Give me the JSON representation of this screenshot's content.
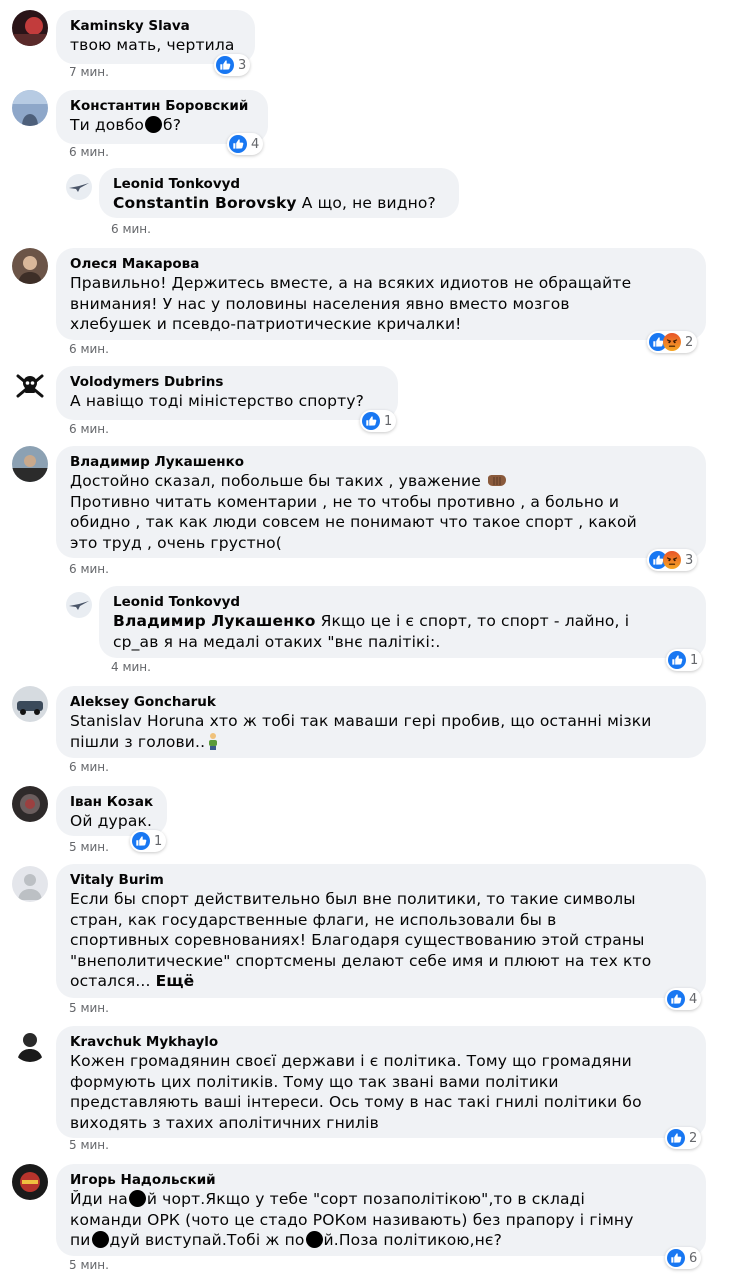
{
  "comments": [
    {
      "author": "Kaminsky Slava",
      "text": "твою мать, чертила",
      "time": "7 мин.",
      "reactions": "3",
      "avatar": "avatar-image"
    },
    {
      "author": "Константин Боровский",
      "text_a": "Ти довбо",
      "text_b": "б?",
      "time": "6 мин.",
      "reactions": "4",
      "avatar": "avatar-image"
    },
    {
      "author": "Leonid Tonkovyd",
      "mention": "Constantin Borovsky",
      "text": " А що, не видно?",
      "time": "6 мин.",
      "avatar": "airplane-avatar"
    },
    {
      "author": "Олеся Макарова",
      "lines": [
        "Правильно! Держитесь вместе, а на всяких идиотов не обращайте",
        "внимания! У нас у половины населения явно вместо мозгов",
        "хлебушек и псевдо-патриотические кричалки!"
      ],
      "time": "6 мин.",
      "reactions": "2"
    },
    {
      "author": "Volodymers Dubrins",
      "text": "А навіщо тоді міністерство спорту?",
      "time": "6 мин.",
      "reactions": "1",
      "avatar": "skull-avatar"
    },
    {
      "author": "Владимир Лукашенко",
      "lines": [
        "Достойно сказал, побольше бы таких , уважение",
        "Противно читать коментарии , не то чтобы противно , а больно и",
        "обидно , так как люди совсем не понимают что такое спорт , какой",
        "это труд , очень грустно("
      ],
      "time": "6 мин.",
      "reactions": "3"
    },
    {
      "author": "Leonid Tonkovyd",
      "mention": "Владимир Лукашенко",
      "lines": [
        " Якщо це і є спорт, то спорт - лайно, і",
        "ср_ав я на медалі отаких \"внє палітікі:."
      ],
      "time": "4 мин.",
      "reactions": "1"
    },
    {
      "author": "Aleksey Goncharuk",
      "lines": [
        "Stanislav Horuna хто ж тобі так маваши гері пробив, що останні мізки",
        "пішли з голови.."
      ],
      "time": "6 мин."
    },
    {
      "author": "Іван Козак",
      "text": "Ой дурак.",
      "time": "5 мин.",
      "reactions": "1"
    },
    {
      "author": "Vitaly Burim",
      "lines": [
        "Если бы спорт действительно был вне политики, то такие символы",
        "стран, как государственные флаги, не использовали бы в",
        "спортивных соревнованиях! Благодаря существованию этой страны",
        "\"внеполитические\" спортсмены делают себе имя и плюют на тех кто",
        "остался..."
      ],
      "more": "Ещё",
      "time": "5 мин.",
      "reactions": "4"
    },
    {
      "author": "Kravchuk Mykhaylo",
      "lines": [
        "Кожен громадянин своєї держави і є політика. Тому що громадяни",
        "формують цих політиків. Тому що так звані вами політики",
        "представляють ваші інтереси. Ось тому в нас такі гнилі політики бо",
        "виходять з тахих аполітичних гнилів"
      ],
      "time": "5 мин.",
      "reactions": "2"
    },
    {
      "author": "Игорь Надольский",
      "l1a": "Йди на",
      "l1b": "й чорт.Якщо у тебе \"сорт позаполітікою\",то в складі",
      "l2": "команди ОРК (чото це стадо РОКом називають) без прапору і гімну",
      "l3a": "пи",
      "l3b": "дуй виступай.Тобі ж по",
      "l3c": "й.Поза політикою,нє?",
      "time": "5 мин.",
      "reactions": "6"
    }
  ],
  "colors": {
    "like": "#1877f2",
    "angry_top": "#f5a623",
    "angry_bottom": "#e8542a",
    "bubble": "#f0f2f5",
    "meta": "#65676b"
  }
}
